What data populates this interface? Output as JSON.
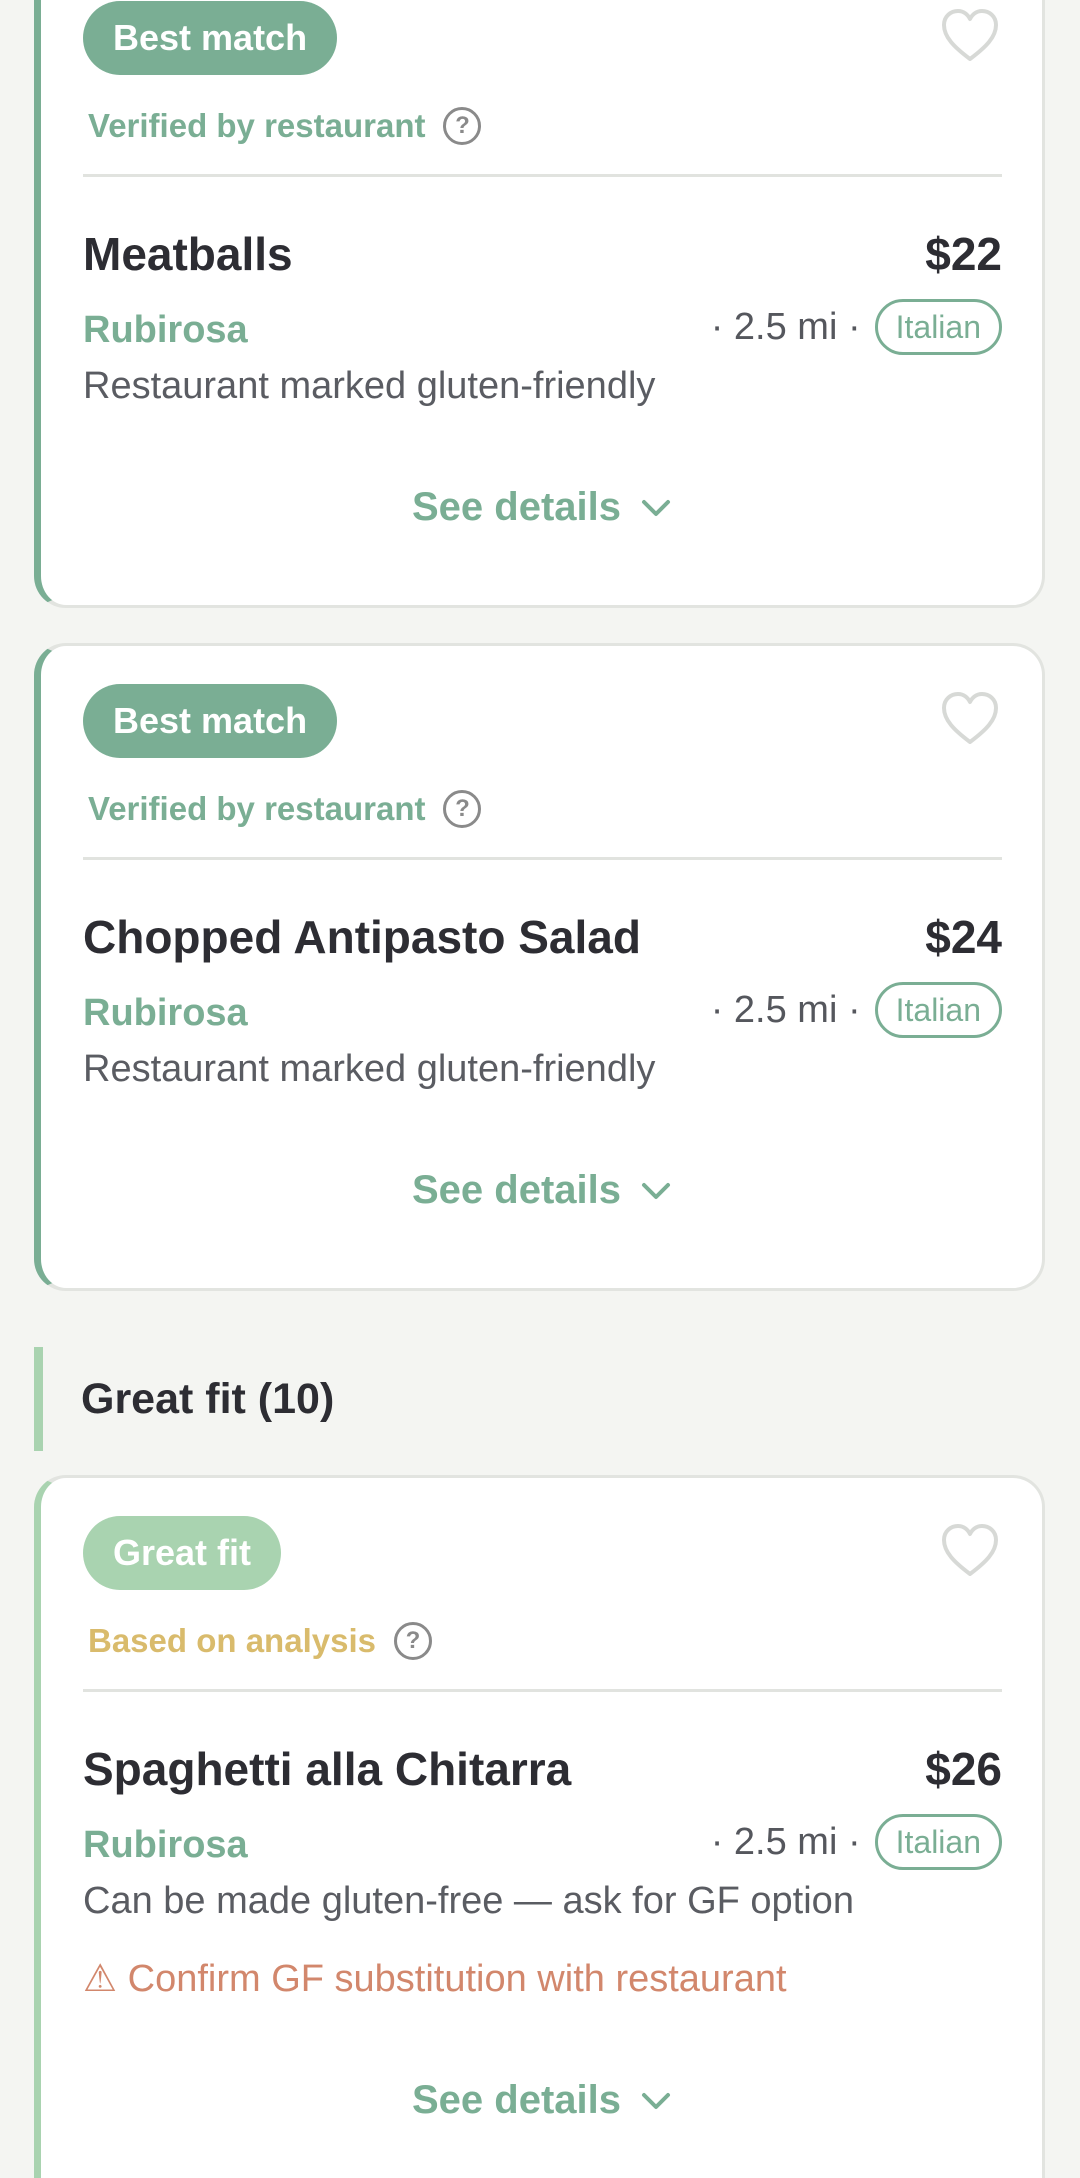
{
  "cards_top": [
    {
      "badge": "Best match",
      "verification": "Verified by restaurant",
      "help_glyph": "?",
      "dish": "Meatballs",
      "price": "$22",
      "restaurant": "Rubirosa",
      "distance": "· 2.5 mi ·",
      "cuisine": "Italian",
      "note": "Restaurant marked gluten-friendly",
      "details_label": "See details"
    },
    {
      "badge": "Best match",
      "verification": "Verified by restaurant",
      "help_glyph": "?",
      "dish": "Chopped Antipasto Salad",
      "price": "$24",
      "restaurant": "Rubirosa",
      "distance": "· 2.5 mi ·",
      "cuisine": "Italian",
      "note": "Restaurant marked gluten-friendly",
      "details_label": "See details"
    }
  ],
  "section": {
    "title": "Great fit (10)"
  },
  "cards_great": [
    {
      "badge": "Great fit",
      "verification": "Based on analysis",
      "help_glyph": "?",
      "dish": "Spaghetti alla Chitarra",
      "price": "$26",
      "restaurant": "Rubirosa",
      "distance": "· 2.5 mi ·",
      "cuisine": "Italian",
      "note": "Can be made gluten-free — ask for GF option",
      "warning": "⚠ Confirm GF substitution with restaurant",
      "details_label": "See details"
    }
  ],
  "icons": {
    "favorite": "heart-outline-icon",
    "help": "question-circle-icon",
    "expand": "chevron-down-icon"
  },
  "colors": {
    "accent_green": "#7aae94",
    "light_green": "#a9d3b0",
    "analysis_gold": "#d9bb6c",
    "warning_orange": "#d2876c"
  }
}
